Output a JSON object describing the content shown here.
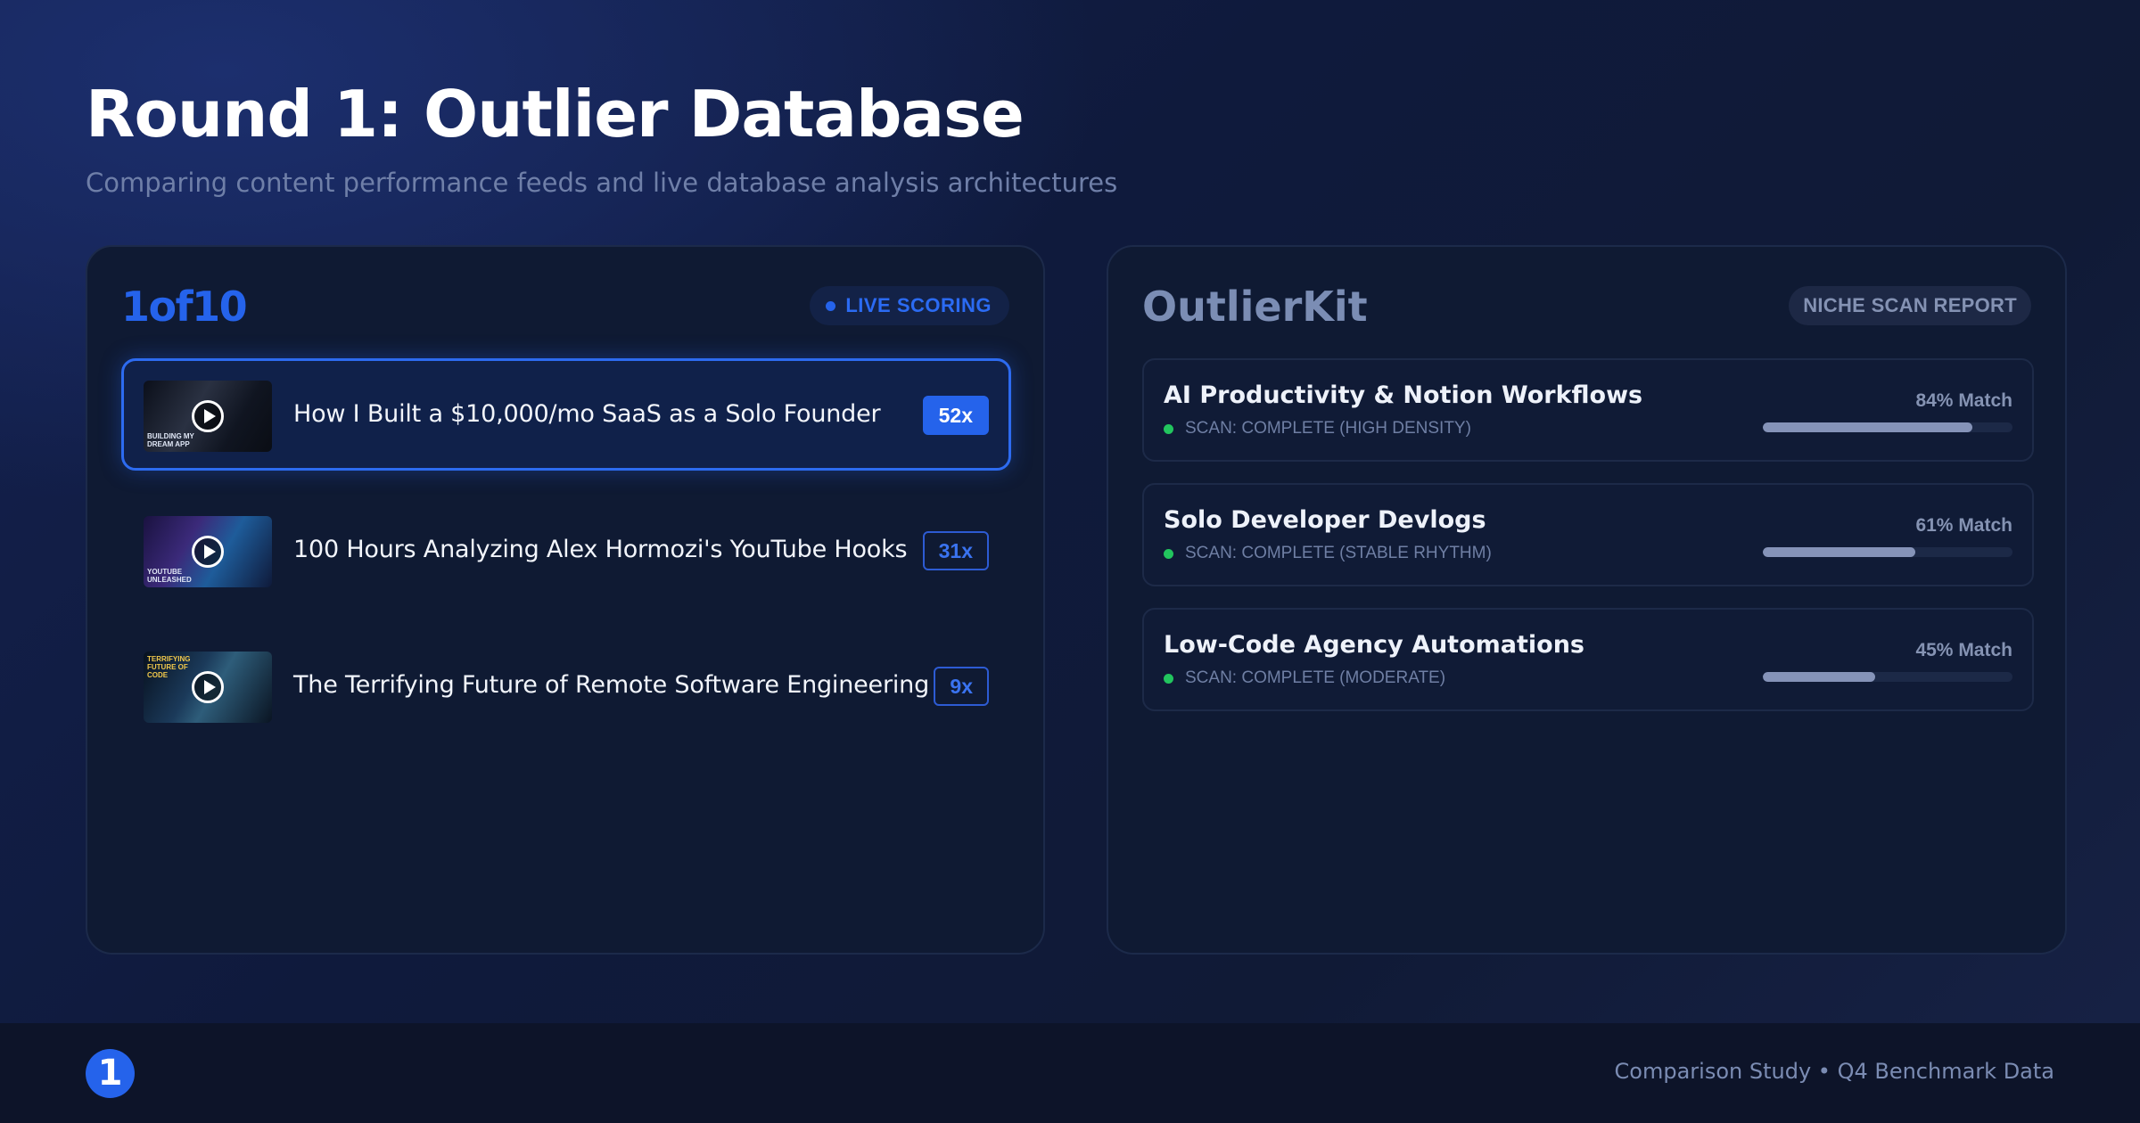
{
  "header": {
    "title": "Round 1: Outlier Database",
    "subtitle": "Comparing content performance feeds and live database analysis architectures"
  },
  "left_panel": {
    "brand": "1of10",
    "status_pill": "LIVE SCORING",
    "items": [
      {
        "title": "How I Built a $10,000/mo SaaS as a Solo Founder",
        "score": "52x",
        "active": true,
        "thumb_caption": "BUILDING MY DREAM APP"
      },
      {
        "title": "100 Hours Analyzing Alex Hormozi's YouTube Hooks",
        "score": "31x",
        "active": false,
        "thumb_caption": "YOUTUBE UNLEASHED"
      },
      {
        "title": "The Terrifying Future of Remote Software Engineering",
        "score": "9x",
        "active": false,
        "thumb_caption": "TERRIFYING FUTURE OF CODE"
      }
    ]
  },
  "right_panel": {
    "brand": "OutlierKit",
    "status_pill": "NICHE SCAN REPORT",
    "niches": [
      {
        "name": "AI Productivity & Notion Workflows",
        "status": "SCAN: COMPLETE (HIGH DENSITY)",
        "match_label": "84% Match",
        "match": 0.84
      },
      {
        "name": "Solo Developer Devlogs",
        "status": "SCAN: COMPLETE (STABLE RHYTHM)",
        "match_label": "61% Match",
        "match": 0.61
      },
      {
        "name": "Low-Code Agency Automations",
        "status": "SCAN: COMPLETE (MODERATE)",
        "match_label": "45% Match",
        "match": 0.45
      }
    ]
  },
  "footer": {
    "logo_glyph": "1",
    "caption": "Comparison Study • Q4 Benchmark Data"
  },
  "colors": {
    "accent": "#2563eb",
    "status_ok": "#22c55e",
    "panel": "#0f1a33"
  }
}
